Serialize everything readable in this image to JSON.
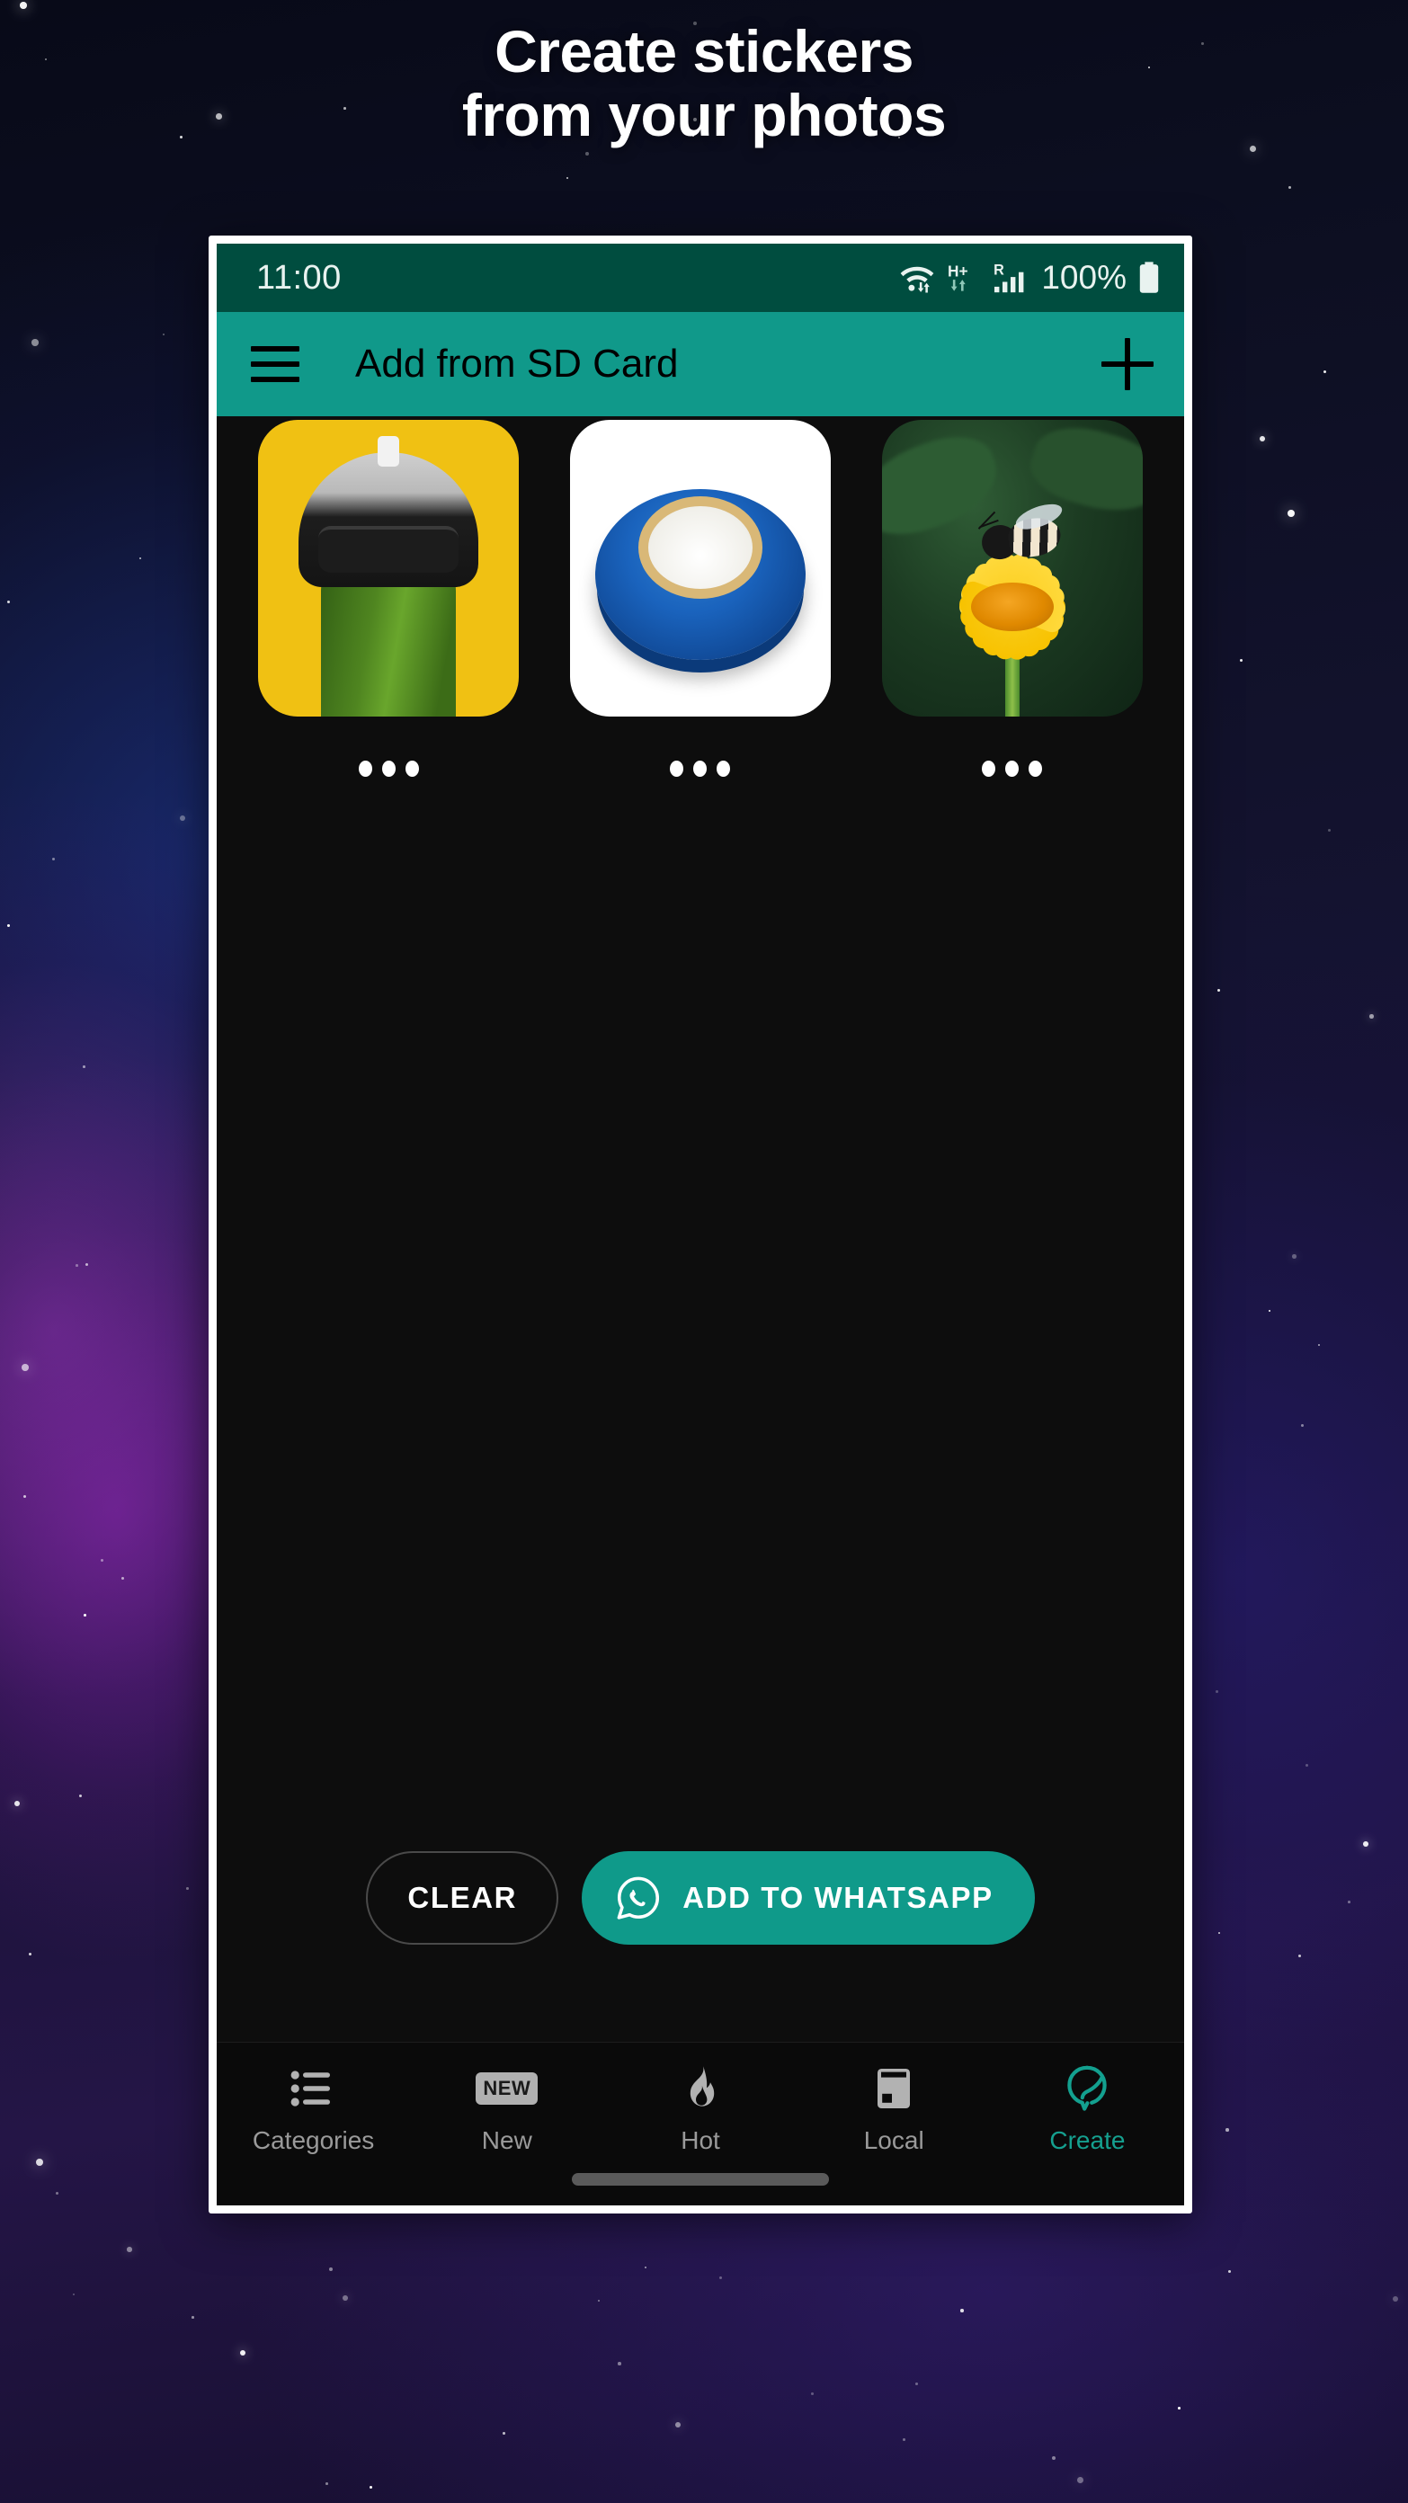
{
  "promo": {
    "headline_line1": "Create stickers",
    "headline_line2": "from your photos"
  },
  "colors": {
    "status_bar": "#004d3f",
    "toolbar": "#10998a",
    "accent": "#0f9a8a",
    "active_tab": "#15a08f",
    "screen_bg": "#0d0d0d"
  },
  "statusbar": {
    "time": "11:00",
    "battery_percent": "100%",
    "icons": [
      "wifi-icon",
      "hplus-data-icon",
      "roaming-signal-icon",
      "battery-icon"
    ]
  },
  "toolbar": {
    "menu_icon": "hamburger-menu-icon",
    "title": "Add from SD Card",
    "add_icon": "plus-icon"
  },
  "stickers": [
    {
      "name": "pickle-in-helmet",
      "overflow_label": "overflow-menu"
    },
    {
      "name": "blue-electrical-tape",
      "overflow_label": "overflow-menu"
    },
    {
      "name": "bee-on-yellow-flower",
      "overflow_label": "overflow-menu"
    }
  ],
  "actions": {
    "clear_label": "CLEAR",
    "whatsapp_label": "ADD TO WHATSAPP",
    "whatsapp_icon": "whatsapp-icon"
  },
  "bottom_nav": {
    "items": [
      {
        "label": "Categories",
        "icon": "list-icon",
        "active": false
      },
      {
        "label": "New",
        "icon": "new-badge-icon",
        "active": false
      },
      {
        "label": "Hot",
        "icon": "flame-icon",
        "active": false
      },
      {
        "label": "Local",
        "icon": "save-card-icon",
        "active": false
      },
      {
        "label": "Create",
        "icon": "create-leaf-icon",
        "active": true
      }
    ]
  }
}
